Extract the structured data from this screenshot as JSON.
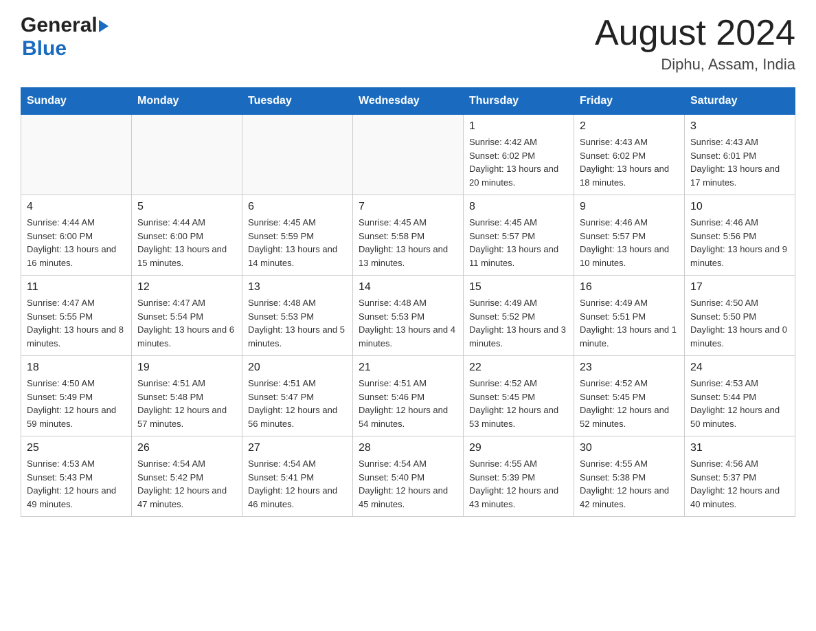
{
  "header": {
    "title": "August 2024",
    "subtitle": "Diphu, Assam, India"
  },
  "logo": {
    "general": "General",
    "blue": "Blue"
  },
  "days": [
    "Sunday",
    "Monday",
    "Tuesday",
    "Wednesday",
    "Thursday",
    "Friday",
    "Saturday"
  ],
  "weeks": [
    [
      {
        "day": "",
        "info": ""
      },
      {
        "day": "",
        "info": ""
      },
      {
        "day": "",
        "info": ""
      },
      {
        "day": "",
        "info": ""
      },
      {
        "day": "1",
        "info": "Sunrise: 4:42 AM\nSunset: 6:02 PM\nDaylight: 13 hours and 20 minutes."
      },
      {
        "day": "2",
        "info": "Sunrise: 4:43 AM\nSunset: 6:02 PM\nDaylight: 13 hours and 18 minutes."
      },
      {
        "day": "3",
        "info": "Sunrise: 4:43 AM\nSunset: 6:01 PM\nDaylight: 13 hours and 17 minutes."
      }
    ],
    [
      {
        "day": "4",
        "info": "Sunrise: 4:44 AM\nSunset: 6:00 PM\nDaylight: 13 hours and 16 minutes."
      },
      {
        "day": "5",
        "info": "Sunrise: 4:44 AM\nSunset: 6:00 PM\nDaylight: 13 hours and 15 minutes."
      },
      {
        "day": "6",
        "info": "Sunrise: 4:45 AM\nSunset: 5:59 PM\nDaylight: 13 hours and 14 minutes."
      },
      {
        "day": "7",
        "info": "Sunrise: 4:45 AM\nSunset: 5:58 PM\nDaylight: 13 hours and 13 minutes."
      },
      {
        "day": "8",
        "info": "Sunrise: 4:45 AM\nSunset: 5:57 PM\nDaylight: 13 hours and 11 minutes."
      },
      {
        "day": "9",
        "info": "Sunrise: 4:46 AM\nSunset: 5:57 PM\nDaylight: 13 hours and 10 minutes."
      },
      {
        "day": "10",
        "info": "Sunrise: 4:46 AM\nSunset: 5:56 PM\nDaylight: 13 hours and 9 minutes."
      }
    ],
    [
      {
        "day": "11",
        "info": "Sunrise: 4:47 AM\nSunset: 5:55 PM\nDaylight: 13 hours and 8 minutes."
      },
      {
        "day": "12",
        "info": "Sunrise: 4:47 AM\nSunset: 5:54 PM\nDaylight: 13 hours and 6 minutes."
      },
      {
        "day": "13",
        "info": "Sunrise: 4:48 AM\nSunset: 5:53 PM\nDaylight: 13 hours and 5 minutes."
      },
      {
        "day": "14",
        "info": "Sunrise: 4:48 AM\nSunset: 5:53 PM\nDaylight: 13 hours and 4 minutes."
      },
      {
        "day": "15",
        "info": "Sunrise: 4:49 AM\nSunset: 5:52 PM\nDaylight: 13 hours and 3 minutes."
      },
      {
        "day": "16",
        "info": "Sunrise: 4:49 AM\nSunset: 5:51 PM\nDaylight: 13 hours and 1 minute."
      },
      {
        "day": "17",
        "info": "Sunrise: 4:50 AM\nSunset: 5:50 PM\nDaylight: 13 hours and 0 minutes."
      }
    ],
    [
      {
        "day": "18",
        "info": "Sunrise: 4:50 AM\nSunset: 5:49 PM\nDaylight: 12 hours and 59 minutes."
      },
      {
        "day": "19",
        "info": "Sunrise: 4:51 AM\nSunset: 5:48 PM\nDaylight: 12 hours and 57 minutes."
      },
      {
        "day": "20",
        "info": "Sunrise: 4:51 AM\nSunset: 5:47 PM\nDaylight: 12 hours and 56 minutes."
      },
      {
        "day": "21",
        "info": "Sunrise: 4:51 AM\nSunset: 5:46 PM\nDaylight: 12 hours and 54 minutes."
      },
      {
        "day": "22",
        "info": "Sunrise: 4:52 AM\nSunset: 5:45 PM\nDaylight: 12 hours and 53 minutes."
      },
      {
        "day": "23",
        "info": "Sunrise: 4:52 AM\nSunset: 5:45 PM\nDaylight: 12 hours and 52 minutes."
      },
      {
        "day": "24",
        "info": "Sunrise: 4:53 AM\nSunset: 5:44 PM\nDaylight: 12 hours and 50 minutes."
      }
    ],
    [
      {
        "day": "25",
        "info": "Sunrise: 4:53 AM\nSunset: 5:43 PM\nDaylight: 12 hours and 49 minutes."
      },
      {
        "day": "26",
        "info": "Sunrise: 4:54 AM\nSunset: 5:42 PM\nDaylight: 12 hours and 47 minutes."
      },
      {
        "day": "27",
        "info": "Sunrise: 4:54 AM\nSunset: 5:41 PM\nDaylight: 12 hours and 46 minutes."
      },
      {
        "day": "28",
        "info": "Sunrise: 4:54 AM\nSunset: 5:40 PM\nDaylight: 12 hours and 45 minutes."
      },
      {
        "day": "29",
        "info": "Sunrise: 4:55 AM\nSunset: 5:39 PM\nDaylight: 12 hours and 43 minutes."
      },
      {
        "day": "30",
        "info": "Sunrise: 4:55 AM\nSunset: 5:38 PM\nDaylight: 12 hours and 42 minutes."
      },
      {
        "day": "31",
        "info": "Sunrise: 4:56 AM\nSunset: 5:37 PM\nDaylight: 12 hours and 40 minutes."
      }
    ]
  ]
}
